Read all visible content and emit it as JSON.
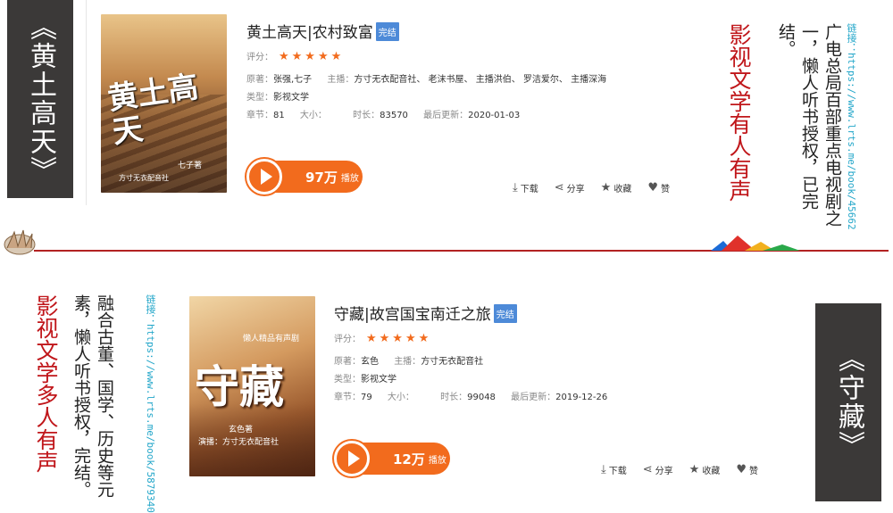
{
  "colors": {
    "accent": "#f26b1d",
    "badge": "#4d8ad8",
    "link": "#22a6c9",
    "red_text": "#c0161a",
    "title_box": "#3b3938",
    "divider": "#b22222"
  },
  "book1": {
    "side_title": "《黄土高天》",
    "cover_text": "黄土高天",
    "cover_author": "七子著",
    "cover_publisher": "方寸无衣配音社",
    "title": "黄土高天|农村致富",
    "badge": "完结",
    "rating_label": "评分：",
    "rating": 5,
    "stars": "★★★★★",
    "author_label": "原著：",
    "author": "张强,七子",
    "narrator_label": "主播：",
    "narrators": "方寸无衣配音社、 老沫书屋、 主播洪伯、 罗洁爱尔、 主播深海",
    "type_label": "类型：",
    "type": "影视文学",
    "chapters_label": "章节：",
    "chapters": "81",
    "size_label": "大小：",
    "size": "",
    "duration_label": "时长：",
    "duration": "83570",
    "updated_label": "最后更新：",
    "updated": "2020-01-03",
    "plays": "97万",
    "plays_unit": "播放",
    "actions": {
      "download": "下载",
      "share": "分享",
      "collect": "收藏",
      "like": "赞"
    },
    "red_caption": "影视文学有人有声",
    "description": "广电总局百部重点电视剧之一，懒人听书授权，已完结。",
    "link_label": "链接：",
    "link": "https://www.lrts.me/book/45662"
  },
  "book2": {
    "side_title": "《守藏》",
    "cover_text": "守藏",
    "cover_series": "懒人精品有声剧",
    "cover_author": "玄色著",
    "cover_publisher": "演播：方寸无衣配音社",
    "title": "守藏|故宫国宝南迁之旅",
    "badge": "完结",
    "rating_label": "评分：",
    "rating": 5,
    "stars": "★★★★★",
    "author_label": "原著：",
    "author": "玄色",
    "narrator_label": "主播：",
    "narrators": "方寸无衣配音社",
    "type_label": "类型：",
    "type": "影视文学",
    "chapters_label": "章节：",
    "chapters": "79",
    "size_label": "大小：",
    "size": "",
    "duration_label": "时长：",
    "duration": "99048",
    "updated_label": "最后更新：",
    "updated": "2019-12-26",
    "plays": "12万",
    "plays_unit": "播放",
    "actions": {
      "download": "下载",
      "share": "分享",
      "collect": "收藏",
      "like": "赞"
    },
    "red_caption": "影视文学多人有声",
    "description": "融合古董、国学、历史等元素，懒人听书授权，完结。",
    "link_label": "链接：",
    "link": "https://www.lrts.me/book/5879340"
  }
}
